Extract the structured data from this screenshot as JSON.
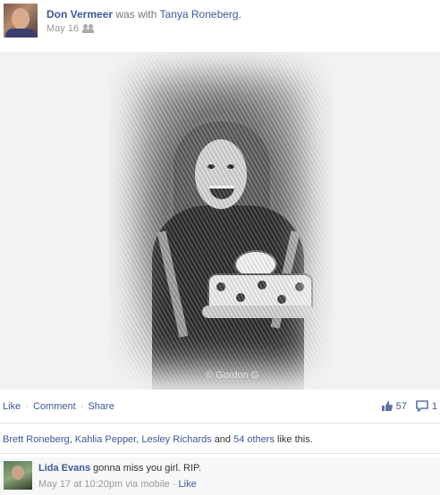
{
  "post": {
    "author": "Don Vermeer",
    "with_text": "was with",
    "tagged": "Tanya Roneberg.",
    "date": "May 16",
    "privacy_icon": "friends-icon"
  },
  "photo": {
    "watermark": "© Gordon G"
  },
  "actions": {
    "like": "Like",
    "separator": "·",
    "comment": "Comment",
    "share": "Share",
    "like_count": "57",
    "comment_count": "1"
  },
  "likes_summary": {
    "names": [
      "Brett Roneberg",
      "Kahlia Pepper",
      "Lesley Richards"
    ],
    "comma": ",",
    "and": "and",
    "others": "54 others",
    "suffix": "like this."
  },
  "comment": {
    "author": "Lida Evans",
    "text": "gonna miss you girl. RIP.",
    "timestamp": "May 17 at 10:20pm via mobile",
    "like": "Like"
  },
  "colors": {
    "link": "#3b5998",
    "muted": "#999999",
    "comment_bg": "#f6f7f9"
  }
}
